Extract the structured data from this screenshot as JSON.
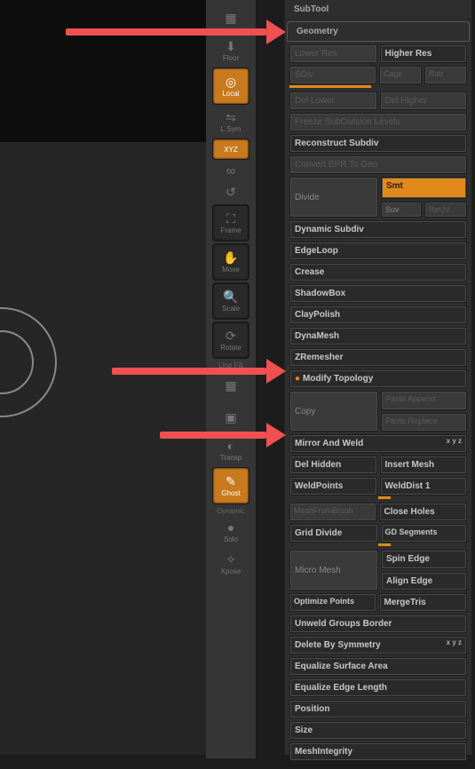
{
  "toolstrip": {
    "grid": "",
    "floor": "Floor",
    "local": "Local",
    "lsym": "L.Sym",
    "xyz": "XYZ",
    "link": "",
    "undo": "",
    "frame": "Frame",
    "move": "Move",
    "scale": "Scale",
    "rotate": "Rotate",
    "linefill": "Line Fill",
    "persp": "",
    "transp": "Transp",
    "ghost": "Ghost",
    "dynamic": "Dynamic",
    "solo": "Solo",
    "xpose": "Xpose"
  },
  "headers": {
    "subtool": "SubTool",
    "geometry": "Geometry",
    "modify": "Modify Topology"
  },
  "geo": {
    "lowerRes": "Lower Res",
    "higherRes": "Higher Res",
    "sdiv": "SDiv",
    "cage": "Cage",
    "rstr": "Rstr",
    "delLower": "Del Lower",
    "delHigher": "Del Higher",
    "freeze": "Freeze SubDivision Levels",
    "reconstruct": "Reconstruct Subdiv",
    "convert": "Convert BPR To Geo",
    "divide": "Divide",
    "smt": "Smt",
    "suv": "Suv",
    "reuv": "ReUV",
    "dynamicSubdiv": "Dynamic Subdiv",
    "edgeloop": "EdgeLoop",
    "crease": "Crease",
    "shadowbox": "ShadowBox",
    "claypolish": "ClayPolish",
    "dynamesh": "DynaMesh",
    "zremesher": "ZRemesher"
  },
  "mod": {
    "copy": "Copy",
    "pasteAppend": "Paste Append",
    "pasteReplace": "Paste Replace",
    "mirrorWeld": "Mirror And Weld",
    "delHidden": "Del Hidden",
    "insertMesh": "Insert Mesh",
    "weldPoints": "WeldPoints",
    "weldDist": "WeldDist 1",
    "meshFromBrush": "MeshFromBrush",
    "closeHoles": "Close Holes",
    "gridDivide": "Grid Divide",
    "gdSegments": "GD Segments",
    "microMesh": "Micro Mesh",
    "spinEdge": "Spin Edge",
    "alignEdge": "Align Edge",
    "optimize": "Optimize Points",
    "mergeTris": "MergeTris",
    "unweld": "Unweld Groups Border",
    "deleteSym": "Delete By Symmetry",
    "equalArea": "Equalize Surface Area",
    "equalEdge": "Equalize Edge Length",
    "position": "Position",
    "size": "Size",
    "meshIntegrity": "MeshIntegrity"
  }
}
